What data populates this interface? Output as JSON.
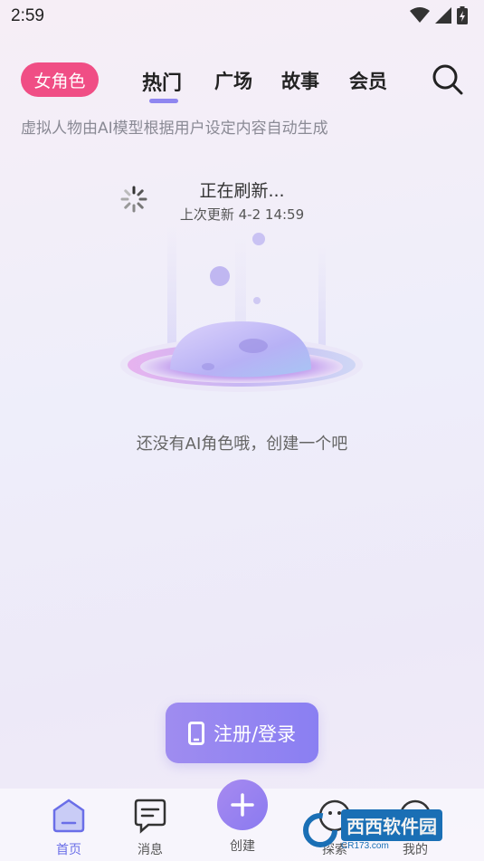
{
  "status": {
    "time": "2:59"
  },
  "header": {
    "role_pill": "女角色",
    "tabs": [
      {
        "label": "热门",
        "active": true
      },
      {
        "label": "广场",
        "active": false
      },
      {
        "label": "故事",
        "active": false
      },
      {
        "label": "会员",
        "active": false
      }
    ],
    "search_icon": "search-icon"
  },
  "subtitle": "虚拟人物由AI模型根据用户设定内容自动生成",
  "refresh": {
    "title": "正在刷新...",
    "last_update": "上次更新 4-2 14:59"
  },
  "empty": {
    "text": "还没有AI角色哦，创建一个吧"
  },
  "login_button": {
    "label": "注册/登录",
    "icon": "phone-icon"
  },
  "bottom_nav": {
    "items": [
      {
        "label": "首页",
        "icon": "home-icon",
        "active": true
      },
      {
        "label": "消息",
        "icon": "message-icon",
        "active": false
      },
      {
        "label": "创建",
        "icon": "plus-icon",
        "active": false
      },
      {
        "label": "探索",
        "icon": "explore-icon",
        "active": false
      },
      {
        "label": "我的",
        "icon": "profile-icon",
        "active": false
      }
    ]
  },
  "watermark": {
    "text": "西西软件园",
    "sub": "CR173.com"
  },
  "colors": {
    "accent": "#8f86f0",
    "pill": "#f04e85"
  }
}
